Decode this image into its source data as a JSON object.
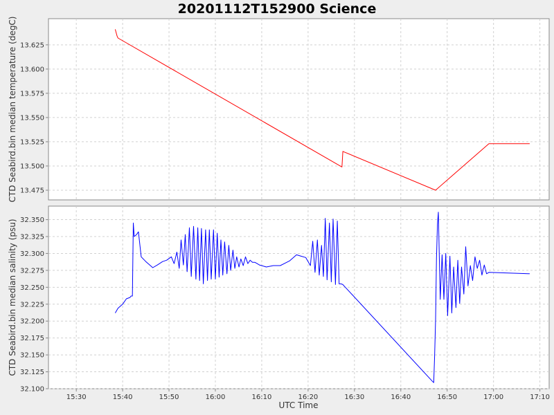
{
  "chart_data": [
    {
      "type": "line",
      "title": "20201112T152900 Science",
      "xlabel": "",
      "ylabel": "CTD Seabird.bin median temperature (degC)",
      "ylim": [
        13.465,
        13.652
      ],
      "xlim": [
        "15:24",
        "17:12"
      ],
      "y_ticks": [
        "13.475",
        "13.500",
        "13.525",
        "13.550",
        "13.575",
        "13.600",
        "13.625"
      ],
      "grid": true,
      "color": "#ff0000",
      "series": [
        {
          "x": [
            "15:38:24",
            "15:38:48",
            "15:39:00",
            "16:27:18",
            "16:27:30",
            "16:47:30",
            "16:59:00",
            "17:07:48"
          ],
          "values": [
            13.641,
            13.634,
            13.632,
            13.499,
            13.515,
            13.475,
            13.523,
            13.523
          ]
        }
      ]
    },
    {
      "type": "line",
      "xlabel": "UTC Time",
      "ylabel": "CTD Seabird.bin median salinity (psu)",
      "ylim": [
        32.1,
        32.37
      ],
      "xlim": [
        "15:24",
        "17:12"
      ],
      "y_ticks": [
        "32.100",
        "32.125",
        "32.150",
        "32.175",
        "32.200",
        "32.225",
        "32.250",
        "32.275",
        "32.300",
        "32.325",
        "32.350"
      ],
      "x_ticks": [
        "15:30",
        "15:40",
        "15:50",
        "16:00",
        "16:10",
        "16:20",
        "16:30",
        "16:40",
        "16:50",
        "17:00",
        "17:10"
      ],
      "grid": true,
      "color": "#0000ff",
      "series": [
        {
          "x": [
            "15:38:24",
            "15:39:00",
            "15:40:00",
            "15:40:48",
            "15:41:36",
            "15:41:48",
            "15:42:06",
            "15:42:18",
            "15:42:30",
            "15:43:00",
            "15:43:24",
            "15:44:00",
            "15:45:00",
            "15:46:30",
            "15:47:30",
            "15:48:36",
            "15:49:30",
            "15:50:30",
            "15:51:06",
            "15:51:42",
            "15:52:12",
            "15:52:36",
            "15:53:06",
            "15:53:30",
            "15:53:54",
            "15:54:24",
            "15:54:48",
            "15:55:18",
            "15:55:48",
            "15:56:12",
            "15:56:36",
            "15:57:00",
            "15:57:24",
            "15:57:54",
            "15:58:18",
            "15:58:42",
            "15:59:06",
            "15:59:36",
            "16:00:00",
            "16:00:24",
            "16:00:48",
            "16:01:12",
            "16:01:36",
            "16:02:00",
            "16:02:30",
            "16:02:54",
            "16:03:18",
            "16:03:48",
            "16:04:12",
            "16:04:36",
            "16:05:06",
            "16:05:30",
            "16:06:00",
            "16:06:30",
            "16:07:00",
            "16:07:30",
            "16:08:00",
            "16:08:30",
            "16:09:00",
            "16:09:30",
            "16:10:00",
            "16:11:00",
            "16:12:30",
            "16:14:00",
            "16:16:00",
            "16:17:30",
            "16:18:30",
            "16:19:30",
            "16:20:30",
            "16:21:00",
            "16:21:30",
            "16:22:00",
            "16:22:24",
            "16:22:54",
            "16:23:18",
            "16:23:42",
            "16:24:06",
            "16:24:36",
            "16:25:00",
            "16:25:24",
            "16:25:54",
            "16:26:18",
            "16:26:42",
            "16:27:06",
            "16:27:30",
            "16:27:54",
            "16:28:18",
            "16:46:48",
            "16:47:06",
            "16:47:18",
            "16:47:30",
            "16:47:42",
            "16:47:54",
            "16:48:06",
            "16:48:30",
            "16:48:54",
            "16:49:18",
            "16:49:42",
            "16:50:06",
            "16:50:36",
            "16:51:00",
            "16:51:24",
            "16:51:54",
            "16:52:18",
            "16:52:42",
            "16:53:06",
            "16:53:36",
            "16:54:00",
            "16:54:30",
            "16:55:00",
            "16:55:30",
            "16:56:00",
            "16:56:30",
            "16:57:00",
            "16:57:30",
            "16:58:00",
            "16:58:30",
            "16:59:00",
            "17:07:48"
          ],
          "values": [
            32.212,
            32.219,
            32.225,
            32.233,
            32.235,
            32.237,
            32.237,
            32.345,
            32.325,
            32.328,
            32.332,
            32.295,
            32.288,
            32.279,
            32.283,
            32.288,
            32.29,
            32.295,
            32.285,
            32.302,
            32.278,
            32.32,
            32.283,
            32.328,
            32.273,
            32.338,
            32.266,
            32.34,
            32.262,
            32.338,
            32.26,
            32.337,
            32.255,
            32.335,
            32.26,
            32.335,
            32.262,
            32.335,
            32.262,
            32.33,
            32.265,
            32.32,
            32.268,
            32.317,
            32.27,
            32.312,
            32.275,
            32.305,
            32.278,
            32.295,
            32.28,
            32.292,
            32.282,
            32.295,
            32.285,
            32.29,
            32.287,
            32.287,
            32.285,
            32.283,
            32.282,
            32.28,
            32.282,
            32.282,
            32.289,
            32.298,
            32.296,
            32.294,
            32.282,
            32.318,
            32.272,
            32.32,
            32.268,
            32.312,
            32.266,
            32.352,
            32.261,
            32.345,
            32.258,
            32.351,
            32.254,
            32.348,
            32.255,
            32.255,
            32.254,
            32.251,
            32.248,
            32.111,
            32.109,
            32.148,
            32.202,
            32.293,
            32.343,
            32.361,
            32.232,
            32.298,
            32.232,
            32.3,
            32.208,
            32.296,
            32.212,
            32.28,
            32.22,
            32.29,
            32.226,
            32.28,
            32.24,
            32.31,
            32.252,
            32.282,
            32.26,
            32.295,
            32.278,
            32.29,
            32.268,
            32.283,
            32.27,
            32.272,
            32.27
          ]
        }
      ]
    }
  ]
}
